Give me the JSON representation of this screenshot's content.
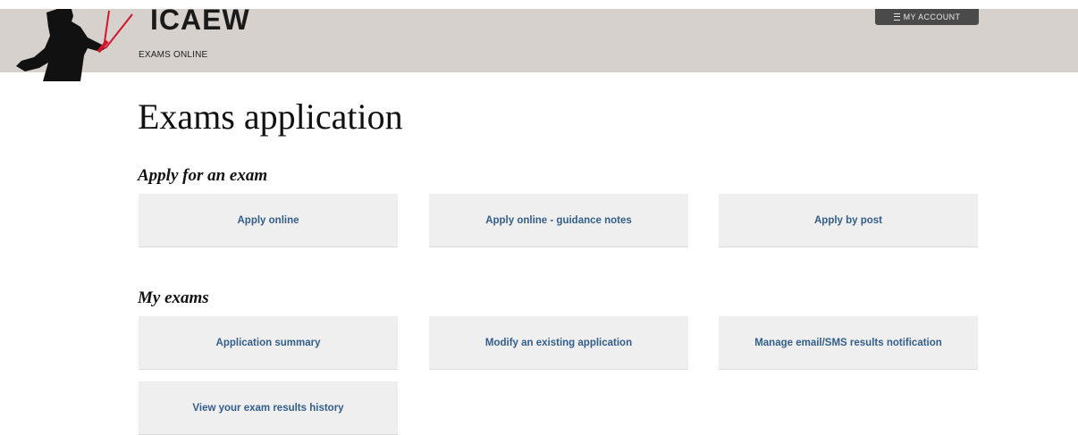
{
  "header": {
    "brand": "ICAEW",
    "subtitle": "EXAMS ONLINE",
    "account_button": "MY ACCOUNT",
    "account_icon": "hamburger-menu-icon",
    "background_color": "#d6d1cc"
  },
  "main": {
    "title": "Exams application",
    "sections": [
      {
        "heading": "Apply for an exam",
        "links": [
          "Apply online",
          "Apply online - guidance notes",
          "Apply by post"
        ]
      },
      {
        "heading": "My exams",
        "links": [
          "Application summary",
          "Modify an existing application",
          "Manage email/SMS results notification",
          "View your exam results history"
        ]
      }
    ]
  },
  "colors": {
    "link": "#335e8a",
    "card_background": "#efefef",
    "account_button": "#4a4a4a"
  }
}
